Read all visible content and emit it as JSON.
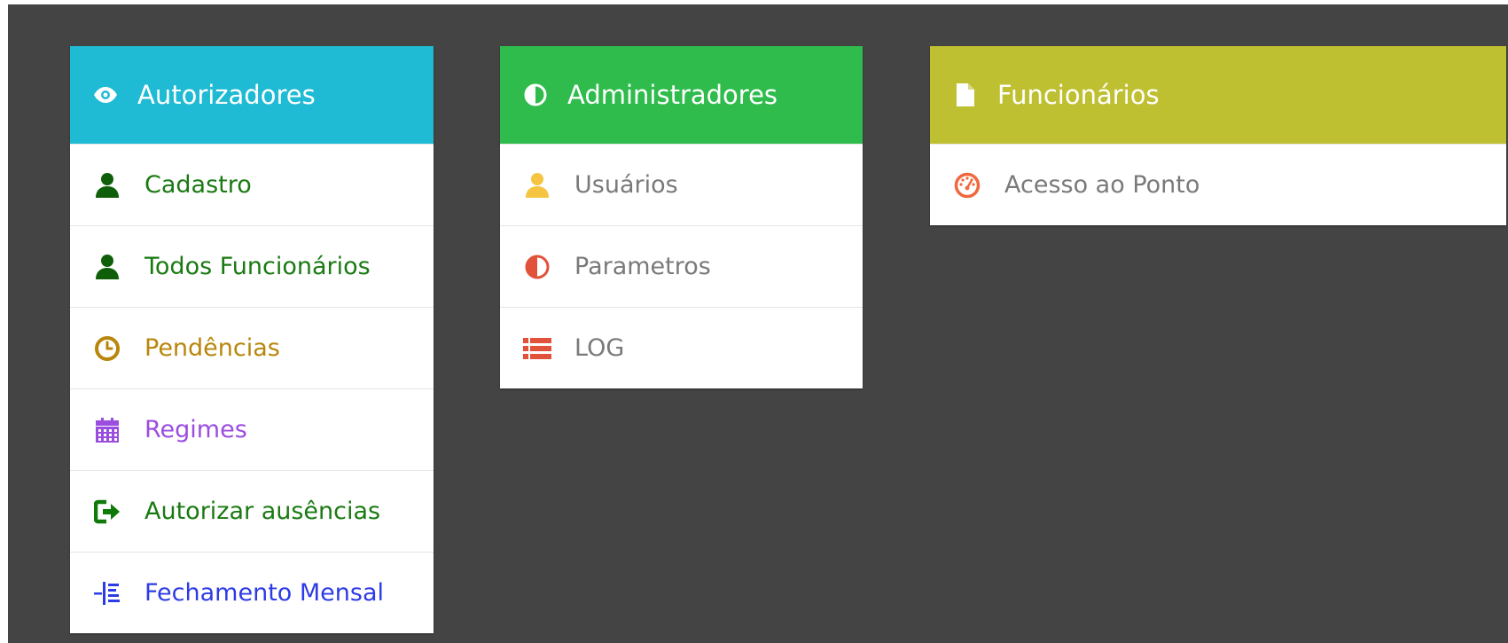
{
  "colors": {
    "autorizadores_header": "#1fbad3",
    "administradores_header": "#2fbc4c",
    "funcionarios_header": "#bfbf32",
    "green_text": "#1a7a12",
    "gold_text": "#b8860b",
    "purple_text": "#9b4de0",
    "blue_text": "#2d3be6",
    "gray_text": "#7a7a7a",
    "red_icon": "#e0523a",
    "orange_icon": "#f28a5e",
    "yellow_icon": "#f5c542"
  },
  "autorizadores": {
    "title": "Autorizadores",
    "header_icon": "eye-icon",
    "items": [
      {
        "label": "Cadastro",
        "icon": "user-icon"
      },
      {
        "label": "Todos Funcionários",
        "icon": "user-icon"
      },
      {
        "label": "Pendências",
        "icon": "clock-icon"
      },
      {
        "label": "Regimes",
        "icon": "calendar-icon"
      },
      {
        "label": "Autorizar ausências",
        "icon": "sign-out-icon"
      },
      {
        "label": "Fechamento Mensal",
        "icon": "split-list-icon"
      }
    ]
  },
  "administradores": {
    "title": "Administradores",
    "header_icon": "half-circle-icon",
    "items": [
      {
        "label": "Usuários",
        "icon": "user-icon"
      },
      {
        "label": "Parametros",
        "icon": "half-circle-icon"
      },
      {
        "label": "LOG",
        "icon": "list-icon"
      }
    ]
  },
  "funcionarios": {
    "title": "Funcionários",
    "header_icon": "file-icon",
    "items": [
      {
        "label": "Acesso ao Ponto",
        "icon": "gauge-icon"
      }
    ]
  }
}
